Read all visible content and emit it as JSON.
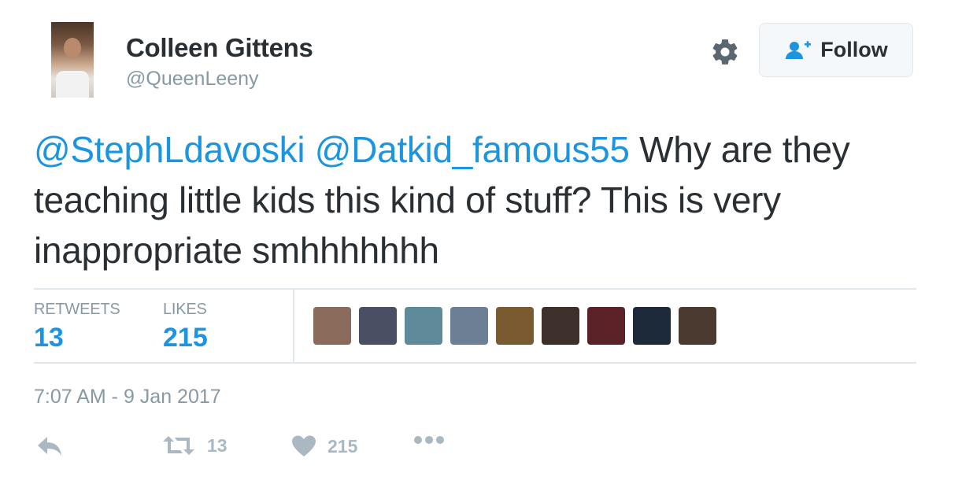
{
  "user": {
    "name": "Colleen Gittens",
    "handle": "@QueenLeeny"
  },
  "header": {
    "follow_label": "Follow"
  },
  "tweet": {
    "mention_1": "@StephLdavoski",
    "mention_2": "@Datkid_famous55",
    "body": " Why are they teaching little kids this kind of stuff? This is very inappropriate smhhhhhhh"
  },
  "stats": {
    "retweets_label": "RETWEETS",
    "retweets_value": "13",
    "likes_label": "LIKES",
    "likes_value": "215"
  },
  "likers": [
    {
      "color": "#8a6a5a",
      "name": "liker-avatar-1"
    },
    {
      "color": "#4b4f63",
      "name": "liker-avatar-2"
    },
    {
      "color": "#5f8a9a",
      "name": "liker-avatar-3"
    },
    {
      "color": "#6d7f94",
      "name": "liker-avatar-4"
    },
    {
      "color": "#7a5a30",
      "name": "liker-avatar-5"
    },
    {
      "color": "#3d2f2a",
      "name": "liker-avatar-6"
    },
    {
      "color": "#5a2226",
      "name": "liker-avatar-7"
    },
    {
      "color": "#1c2a3a",
      "name": "liker-avatar-8"
    },
    {
      "color": "#4a3a30",
      "name": "liker-avatar-9"
    }
  ],
  "meta": {
    "timestamp": "7:07 AM - 9 Jan 2017"
  },
  "actions": {
    "retweet_count": "13",
    "like_count": "215"
  },
  "colors": {
    "accent": "#1b95e0",
    "text": "#292f33",
    "muted": "#8899a6",
    "icon": "#aab8c2"
  }
}
